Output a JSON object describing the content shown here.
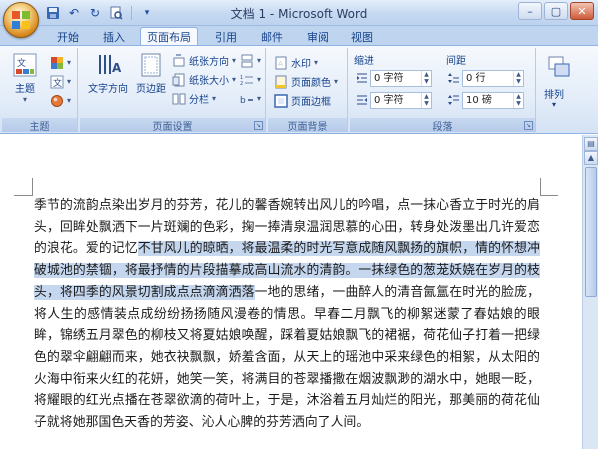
{
  "window": {
    "title": "文档 1 - Microsoft Word",
    "controls": [
      "–",
      "▢",
      "✕"
    ]
  },
  "tabs": [
    {
      "label": "开始",
      "active": false
    },
    {
      "label": "插入",
      "active": false
    },
    {
      "label": "页面布局",
      "active": true
    },
    {
      "label": "引用",
      "active": false
    },
    {
      "label": "邮件",
      "active": false
    },
    {
      "label": "审阅",
      "active": false
    },
    {
      "label": "视图",
      "active": false
    }
  ],
  "ribbon": {
    "theme_group": {
      "label": "主题",
      "theme_button": "主题"
    },
    "page_setup_group": {
      "label": "页面设置",
      "text_direction": "文字方向",
      "margins": "页边距",
      "orientation": "纸张方向",
      "size": "纸张大小",
      "columns": "分栏"
    },
    "background_group": {
      "label": "页面背景",
      "watermark": "水印",
      "page_color": "页面颜色",
      "page_borders": "页面边框"
    },
    "paragraph_group": {
      "label": "段落",
      "indent_label": "缩进",
      "spacing_label": "间距",
      "indent_left": "0 字符",
      "indent_right": "0 字符",
      "spacing_before": "0 行",
      "spacing_after": "10 磅"
    },
    "arrange_group": {
      "label": "排列",
      "arrange_button": "排列"
    }
  },
  "document": {
    "text_before": "季节的流韵点染出岁月的芬芳，花儿的馨香婉转出风儿的吟唱，点一抹心香立于时光的肩头，回眸处飘洒下一片斑斓的色彩，掬一捧清泉温润思慕的心田，转身处泼墨出几许爱恋的浪花。爱的记忆",
    "text_selected": "不甘风儿的晾晒，将最温柔的时光写意成随风飘扬的旗帜，情的怀想冲破城池的禁锢，将最抒情的片段描摹成高山流水的清韵。一抹绿色的葱茏妖娆在岁月的枝头，将四季的风景切割成点点滴滴洒落",
    "text_after": "一地的思绪，一曲醉人的清音氤氲在时光的脸庞，将人生的感情装点成纷纷扬扬随风漫卷的情思。早春二月飘飞的柳絮迷蒙了春姑娘的眼眸，锦绣五月翠色的柳枝又将夏姑娘唤醒，踩着夏姑娘飘飞的裙裾，荷花仙子打着一把绿色的翠伞翩翩而来，她衣袂飘飘，娇羞含面，从天上的瑶池中采来绿色的相絮，从太阳的火海中衔来火红的花妍，她笑一笑，将满目的苍翠播撒在烟波飘渺的湖水中，她眼一眨，将耀眼的红光点播在苍翠欲滴的荷叶上，于是，沐浴着五月灿烂的阳光，那美丽的荷花仙子就将她那国色天香的芳姿、沁人心脾的芬芳洒向了人间。",
    "paragraph_mark": "↵"
  },
  "colors": {
    "selection": "#c5d7ee",
    "ribbon_text": "#15428b"
  }
}
